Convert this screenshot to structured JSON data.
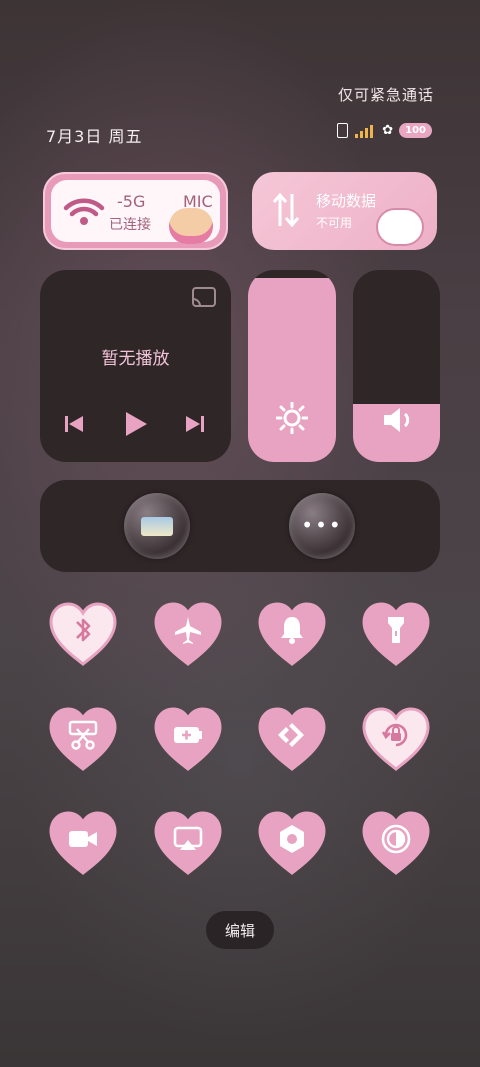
{
  "status": {
    "emergency_text": "仅可紧急通话",
    "date_text": "7月3日 周五",
    "battery": "100"
  },
  "wifi": {
    "ssid_partial": "-5G",
    "ssid_partial2": "MIC",
    "state": "已连接"
  },
  "mobile": {
    "title": "移动数据",
    "state": "不可用"
  },
  "media": {
    "now_playing": "暂无播放"
  },
  "sliders": {
    "brightness_level": 0.96,
    "volume_level": 0.3
  },
  "toggles": [
    {
      "name": "bluetooth",
      "icon": "bluetooth-icon",
      "active": false
    },
    {
      "name": "airplane",
      "icon": "airplane-icon",
      "active": true
    },
    {
      "name": "bell",
      "icon": "bell-icon",
      "active": true
    },
    {
      "name": "flashlight",
      "icon": "flashlight-icon",
      "active": true
    },
    {
      "name": "screenshot",
      "icon": "scissors-icon",
      "active": true
    },
    {
      "name": "battery-saver",
      "icon": "battery-plus-icon",
      "active": true
    },
    {
      "name": "nearby-share",
      "icon": "share-arrows-icon",
      "active": true
    },
    {
      "name": "rotation-lock",
      "icon": "rotation-lock-icon",
      "active": false
    },
    {
      "name": "screen-record",
      "icon": "video-icon",
      "active": true
    },
    {
      "name": "cast",
      "icon": "cast-screen-icon",
      "active": true
    },
    {
      "name": "settings",
      "icon": "hex-nut-icon",
      "active": true
    },
    {
      "name": "dark-mode",
      "icon": "contrast-icon",
      "active": true
    }
  ],
  "edit": {
    "label": "编辑"
  },
  "colors": {
    "pink": "#e7a3c1",
    "pink_light": "#fbe8ef",
    "dark_tile": "#2f2628"
  }
}
